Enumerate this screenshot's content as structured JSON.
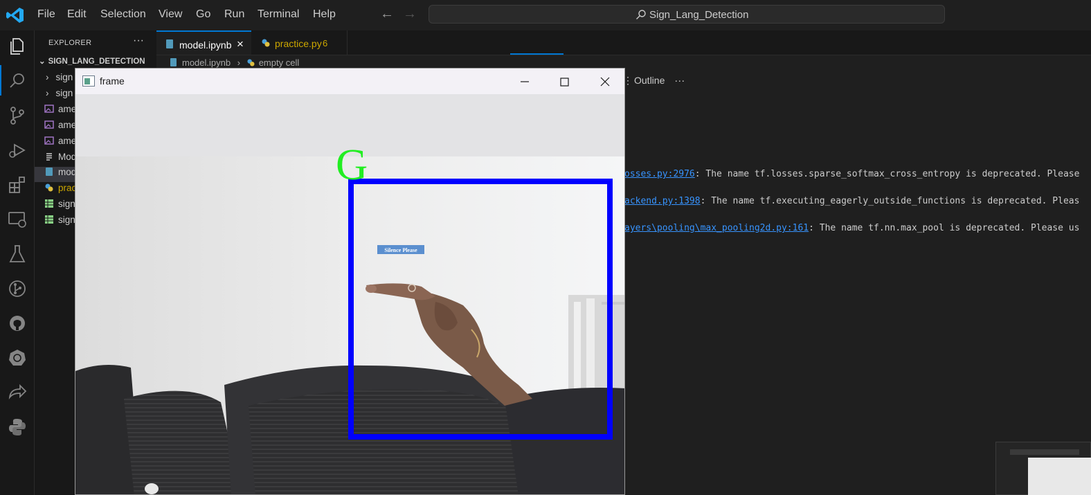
{
  "titlebar": {
    "menu": [
      "File",
      "Edit",
      "Selection",
      "View",
      "Go",
      "Run",
      "Terminal",
      "Help"
    ],
    "search_label": "Sign_Lang_Detection"
  },
  "activitybar": {
    "icons": [
      "explorer-icon",
      "search-icon",
      "source-control-icon",
      "run-debug-icon",
      "extensions-icon",
      "remote-explorer-icon",
      "testing-icon",
      "git-graph-icon",
      "github-icon",
      "kubernetes-icon",
      "live-share-icon",
      "python-icon"
    ]
  },
  "sidebar": {
    "title": "EXPLORER",
    "more": "···",
    "project": "SIGN_LANG_DETECTION",
    "items": [
      {
        "label": "sign",
        "icon": "chevron-right-icon"
      },
      {
        "label": "sign",
        "icon": "chevron-right-icon"
      },
      {
        "label": "ame",
        "icon": "image-file-icon"
      },
      {
        "label": "ame",
        "icon": "image-file-icon"
      },
      {
        "label": "ame",
        "icon": "image-file-icon"
      },
      {
        "label": "Mod",
        "icon": "text-file-icon"
      },
      {
        "label": "mod",
        "icon": "notebook-file-icon"
      },
      {
        "label": "prac",
        "icon": "python-file-icon"
      },
      {
        "label": "sign",
        "icon": "spreadsheet-file-icon"
      },
      {
        "label": "sign",
        "icon": "spreadsheet-file-icon"
      }
    ]
  },
  "tabs": [
    {
      "label": "model.ipynb",
      "close": "×"
    },
    {
      "label": "practice.py",
      "badge": "6"
    }
  ],
  "breadcrumb": {
    "file": "model.ipynb",
    "cell": "empty cell"
  },
  "toolbar": {
    "outline": "Outline",
    "more": "···"
  },
  "output": [
    {
      "link": "osses.py:2976",
      "text": ": The name tf.losses.sparse_softmax_cross_entropy is deprecated. Please"
    },
    {
      "link": "ackend.py:1398",
      "text": ": The name tf.executing_eagerly_outside_functions is deprecated. Pleas"
    },
    {
      "link": "ayers\\pooling\\max_pooling2d.py:161",
      "text": ": The name tf.nn.max_pool is deprecated. Please us"
    }
  ],
  "frame_window": {
    "title": "frame",
    "prediction_letter": "G",
    "wall_sign": "Silence Please",
    "box_color": "#0000ff",
    "letter_color": "#00ff00"
  },
  "colors": {
    "accent": "#0078d4",
    "link": "#3794ff",
    "modified_tab": "#cca700"
  }
}
